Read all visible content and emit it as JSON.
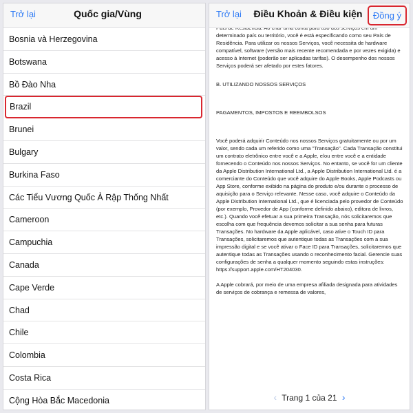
{
  "left": {
    "back_label": "Trở lại",
    "title": "Quốc gia/Vùng",
    "countries": [
      "Bosnia và Herzegovina",
      "Botswana",
      "Bồ Đào Nha",
      "Brazil",
      "Brunei",
      "Bulgary",
      "Burkina Faso",
      "Các Tiểu Vương Quốc Ả Rập Thống Nhất",
      "Cameroon",
      "Campuchia",
      "Canada",
      "Cape Verde",
      "Chad",
      "Chile",
      "Colombia",
      "Costa Rica",
      "Cộng Hòa Bắc Macedonia"
    ],
    "selected_country": "Brazil"
  },
  "right": {
    "back_label": "Trở lại",
    "title": "Điều Khoản & Điều kiện",
    "agree_label": "Đồng ý",
    "paragraphs": [
      "País de Residência. Ao criar uma conta para uso dos serviços em um determinado país ou território, você é está especificando como seu País de Residência. Para utilizar os nossos Serviços, você necessita de hardware compatível, software (versão mais recente recomendada e por vezes exigida) e acesso à Internet (poderão ser aplicadas tarifas). O desempenho dos nossos Serviços poderá ser afetado por estes fatores.",
      "B. UTILIZANDO NOSSOS SERVIÇOS",
      "PAGAMENTOS, IMPOSTOS E REEMBOLSOS",
      "Você poderá adquirir Conteúdo nos nossos Serviços gratuitamente ou por um valor, sendo cada um referido como uma \"Transação\". Cada Transação constitui um contrato eletrônico entre você e a Apple, e/ou entre você e a entidade fornecendo o Conteúdo nos nossos Serviços. No entanto, se você for um cliente da Apple Distribution International Ltd., a Apple Distribution International Ltd. é a comerciante do Conteúdo que você adquire do Apple Books, Apple Podcasts ou App Store, conforme exibido na página do produto e/ou durante o processo de aquisição para o Serviço relevante. Nesse caso, você adquire o Conteúdo da Apple Distribution International Ltd., que é licenciada pelo provedor de Conteúdo (por exemplo, Provedor de App (conforme definido abaixo), editora de livros, etc.). Quando você efetuar a sua primeira Transação, nós solicitaremos que escolha com que frequência devemos solicitar a sua senha para futuras Transações. No hardware da Apple aplicável, caso ative o Touch ID para Transações, solicitaremos que autentique todas as Transações com a sua impressão digital e se você ativar o Face ID para Transações, solicitaremos que autentique todas as Transações usando o reconhecimento facial. Gerencie suas configurações de senha a qualquer momento seguindo estas instruções: https://support.apple.com/HT204030.",
      "A Apple cobrará, por meio de uma empresa afiliada designada para atividades de serviços de cobrança e remessa de valores,"
    ],
    "pager": {
      "prev_icon": "‹",
      "label": "Trang 1 của 21",
      "next_icon": "›"
    }
  },
  "colors": {
    "accent": "#2f7bf5",
    "highlight": "#d9262f"
  }
}
